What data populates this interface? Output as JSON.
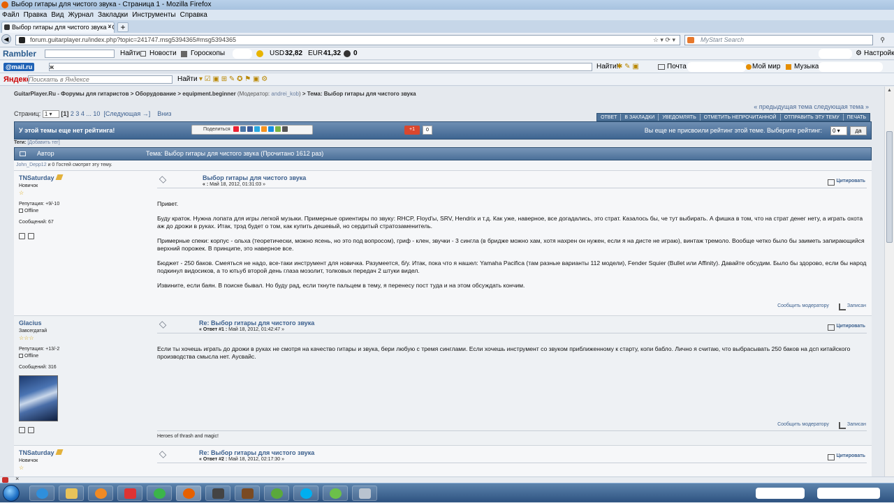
{
  "window": {
    "title": "Выбор гитары для чистого звука - Страница 1 - Mozilla Firefox"
  },
  "menu": [
    "Файл",
    "Правка",
    "Вид",
    "Журнал",
    "Закладки",
    "Инструменты",
    "Справка"
  ],
  "tab": {
    "label": "Выбор гитары для чистого звука - Стр...",
    "close": "×",
    "new": "+"
  },
  "nav": {
    "url": "forum.guitarplayer.ru/index.php?topic=241747.msg5394365#msg5394365",
    "search_placeholder": "MyStart Search"
  },
  "rambler": {
    "logo": "Rambler",
    "find": "Найти",
    "news": "Новости",
    "horoscope": "Гороскопы",
    "usd_label": "USD",
    "usd_value": "32,82",
    "eur_label": "EUR",
    "eur_value": "41,32",
    "mail_count": "0",
    "settings": "Настройки"
  },
  "mailru": {
    "logo": "@mail.ru",
    "input": "ж",
    "find": "Найти!",
    "mail": "Почта",
    "myworld": "Мой мир",
    "music": "Музыка"
  },
  "yandex": {
    "logo": "Яндекс",
    "placeholder": "Поискать в Яндексе",
    "find": "Найти"
  },
  "forum": {
    "breadcrumb": "GuitarPlayer.Ru - Форумы для гитаристов > Оборудование > equipment.beginner",
    "moderator_prefix": "(Модератор:",
    "moderator": "andrei_kob",
    "moderator_suffix": ")",
    "topic_crumb": "> Тема: Выбор гитары для чистого звука",
    "prevnext": "« предыдущая тема следующая тема »",
    "pages_label": "Страниц:",
    "page_select": "1",
    "pages_current": "[1]",
    "pages_links": "2 3 4 ... 10",
    "next_link": "[Следующая →]",
    "down_link": "Вниз",
    "buttons": [
      "ОТВЕТ",
      "В ЗАКЛАДКИ",
      "УВЕДОМЛЯТЬ",
      "ОТМЕТИТЬ НЕПРОЧИТАННОЙ",
      "ОТПРАВИТЬ ЭТУ ТЕМУ",
      "ПЕЧАТЬ"
    ],
    "no_rating": "У этой темы еще нет рейтинга!",
    "share_label": "Поделиться",
    "gplus": "+1",
    "gplus_count": "0",
    "rate_prompt": "Вы еще не присвоили рейтинг этой теме. Выберите рейтинг:",
    "rate_value": "0",
    "rate_button": "да",
    "tags_label": "Теги:",
    "tags_link": "[Добавить тег]",
    "col_author": "Автор",
    "col_topic": "Тема: Выбор гитары для чистого звука  (Прочитано 1612 раз)",
    "viewer_name": "John_Depp12",
    "viewer_rest": "и 0 Гостей смотрят эту тему.",
    "quote": "Цитировать",
    "report": "Сообщить модератору",
    "record": "Записан"
  },
  "posts": [
    {
      "author": "TNSaturday",
      "rank": "Новичок",
      "stars": "☆",
      "reputation": "Репутация: +9/-10",
      "status": "Offline",
      "messages": "Сообщений: 67",
      "subject": "Выбор гитары для чистого звука",
      "date_prefix": "« :",
      "date": "Май 18, 2012, 01:31:03 »",
      "paragraphs": [
        "Привет.",
        "Буду краток. Нужна лопата для игры легкой музыки. Примерные ориентиры по звуку: RHCP, Floyd'ы, SRV, Hendrix и т.д. Как уже, наверное, все догадались, это страт. Казалось бы, че тут выбирать. А фишка в том, что на страт денег нету, а играть охота аж до дрожи в руках. Итак, трэд будет о том, как купить дешевый, но сердитый стратозаменитель.",
        "Примерные спеки: корпус - ольха (теоретически, можно ясень, но это под вопросом), гриф - клен, звучки - 3 сингла (в бридже можно хам, хотя нахрен он нужен, если я на дисте не играю), винтаж тремоло. Вообще четко было бы заиметь запирающийся верхний порожек. В принципе, это наверное все.",
        "Бюджет - 250 баков. Смеяться не надо, все-таки инструмент для новичка. Разумеется, б/у. Итак, пока что я нашел: Yamaha Pacifica (там разные варианты 112 модели), Fender Squier (Bullet или Affinity). Давайте обсудим. Было бы здорово, если бы народ подкинул видосиков, а то ютьуб второй день глаза мозолит, толковых передач 2 штуки видел.",
        "Извините, если баян. В поиске бывал. Но буду рад, если ткнуте пальцем в тему, я перенесу пост туда и на этом обсуждать кончим."
      ]
    },
    {
      "author": "Glacius",
      "rank": "Завсегдатай",
      "stars": "☆☆☆",
      "reputation": "Репутация: +13/-2",
      "status": "Offline",
      "messages": "Сообщений: 316",
      "subject": "Re: Выбор гитары для чистого звука",
      "date_prefix": "« Ответ #1 :",
      "date": "Май 18, 2012, 01:42:47 »",
      "paragraphs": [
        "Если ты хочешь играть до дрожи в руках не смотря на качество гитары и звука, бери любую с тремя синглами. Если хочешь инструмент со звуком приближенному к старту, копи бабло. Лично я считаю, что выбрасывать 250 баков на дсп китайского производства смысла нет. Аусвайс."
      ],
      "signature": "Heroes of thrash and magic!"
    },
    {
      "author": "TNSaturday",
      "rank": "Новичок",
      "stars": "☆",
      "subject": "Re: Выбор гитары для чистого звука",
      "date_prefix": "« Ответ #2 :",
      "date": "Май 18, 2012, 02:17:30 »"
    }
  ],
  "colors": {
    "link": "#3b5f8d",
    "header_bar": "#4b7099",
    "page_bg": "#e5e9ee"
  }
}
